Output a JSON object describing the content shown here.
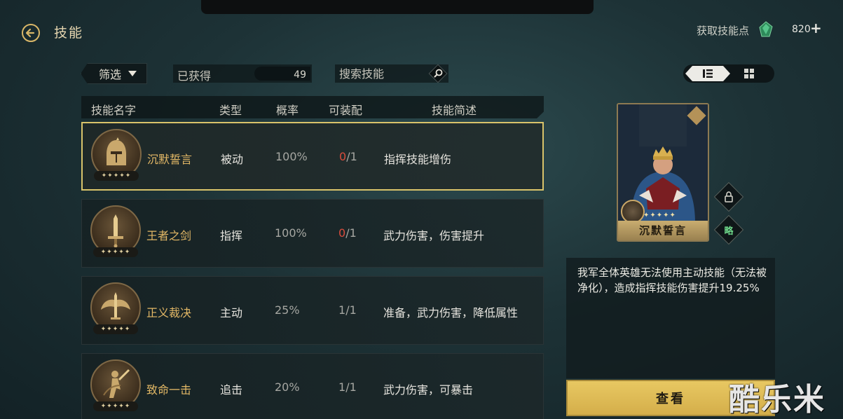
{
  "header": {
    "title": "技能",
    "skill_point_label": "获取技能点",
    "skill_point_value": "820",
    "plus_label": "+"
  },
  "toolbar": {
    "filter_label": "筛选",
    "obtained_label": "已获得",
    "obtained_count": "49",
    "search_placeholder": "搜索技能"
  },
  "table": {
    "headers": [
      "技能名字",
      "类型",
      "概率",
      "可装配",
      "技能简述"
    ],
    "rows": [
      {
        "name": "沉默誓言",
        "type": "被动",
        "rate": "100%",
        "equip_current": "0",
        "equip_total": "/1",
        "desc": "指挥技能增伤",
        "stars": "✦✦✦✦✦",
        "selected": true
      },
      {
        "name": "王者之剑",
        "type": "指挥",
        "rate": "100%",
        "equip_current": "0",
        "equip_total": "/1",
        "desc": "武力伤害，伤害提升",
        "stars": "✦✦✦✦✦"
      },
      {
        "name": "正义裁决",
        "type": "主动",
        "rate": "25%",
        "equip_current": "1",
        "equip_total": "/1",
        "desc": "准备，武力伤害，降低属性",
        "stars": "✦✦✦✦✦"
      },
      {
        "name": "致命一击",
        "type": "追击",
        "rate": "20%",
        "equip_current": "1",
        "equip_total": "/1",
        "desc": "武力伤害，可暴击",
        "stars": "✦✦✦✦✦"
      }
    ]
  },
  "detail": {
    "card_name": "沉默誓言",
    "card_stars": "✦✦✦✦✦",
    "side_button_2": "略",
    "description": "我军全体英雄无法使用主动技能（无法被净化），造成指挥技能伤害提升19.25%",
    "view_button": "查看"
  },
  "watermark": "酷乐米",
  "colors": {
    "accent_gold": "#d9c36a",
    "skill_name": "#e3b866",
    "zero_count": "#d84c3c"
  }
}
